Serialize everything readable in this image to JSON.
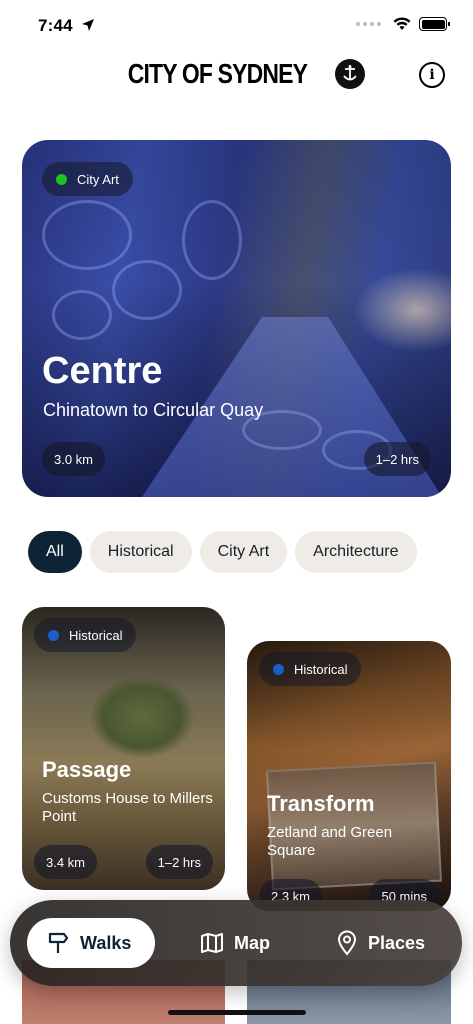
{
  "status_bar": {
    "time": "7:44"
  },
  "header": {
    "logo_text": "CITY OF SYDNEY",
    "info_icon": "info-icon"
  },
  "hero": {
    "category": "City Art",
    "category_color": "#1ec31e",
    "title": "Centre",
    "subtitle": "Chinatown to Circular Quay",
    "distance": "3.0 km",
    "duration": "1–2 hrs"
  },
  "filters": [
    {
      "label": "All",
      "active": true
    },
    {
      "label": "Historical",
      "active": false
    },
    {
      "label": "City Art",
      "active": false
    },
    {
      "label": "Architecture",
      "active": false
    }
  ],
  "cards": [
    {
      "category": "Historical",
      "category_color": "#1e5cc8",
      "title": "Passage",
      "subtitle": "Customs House to Millers Point",
      "distance": "3.4 km",
      "duration": "1–2 hrs"
    },
    {
      "category": "Historical",
      "category_color": "#1e5cc8",
      "title": "Transform",
      "subtitle": "Zetland and Green Square",
      "distance": "2.3 km",
      "duration": "50 mins"
    }
  ],
  "tabbar": {
    "walks": {
      "label": "Walks",
      "icon": "signpost-icon"
    },
    "map": {
      "label": "Map",
      "icon": "map-icon"
    },
    "places": {
      "label": "Places",
      "icon": "location-pin-icon"
    }
  },
  "colors": {
    "primary": "#0f2336",
    "chip_bg": "#efebe6"
  }
}
